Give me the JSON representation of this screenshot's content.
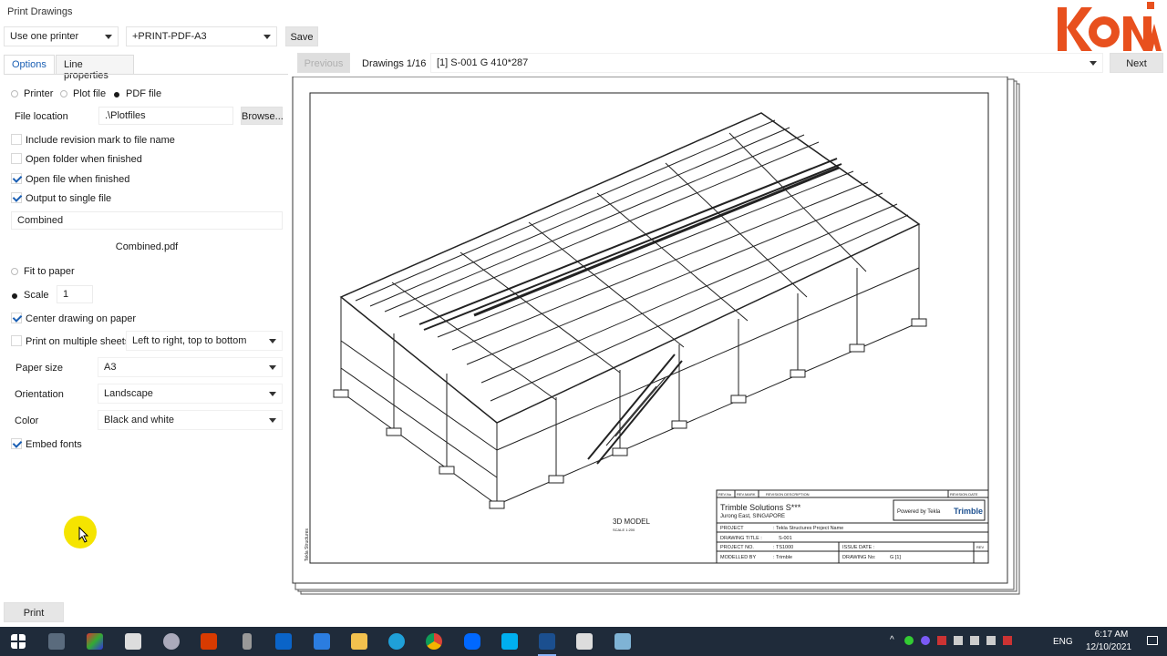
{
  "window": {
    "title": "Print Drawings"
  },
  "toolbar": {
    "printer_mode": "Use one printer",
    "printer_name": "+PRINT-PDF-A3",
    "save_label": "Save"
  },
  "tabs": [
    {
      "label": "Options"
    },
    {
      "label": "Line properties"
    }
  ],
  "options": {
    "output_printer": "Printer",
    "output_plot": "Plot file",
    "output_pdf": "PDF file",
    "file_location_label": "File location",
    "file_location_value": ".\\Plotfiles",
    "browse_label": "Browse...",
    "include_revision": "Include revision mark to file name",
    "open_folder": "Open folder when finished",
    "open_file": "Open file when finished",
    "single_file": "Output to single file",
    "combined_name": "Combined",
    "combined_file": "Combined.pdf",
    "fit_to_paper": "Fit to paper",
    "scale_label": "Scale",
    "scale_value": "1",
    "center_drawing": "Center drawing on paper",
    "multiple_sheets": "Print on multiple sheets",
    "sheet_order": "Left to right, top to bottom",
    "paper_size_label": "Paper size",
    "paper_size_value": "A3",
    "orientation_label": "Orientation",
    "orientation_value": "Landscape",
    "color_label": "Color",
    "color_value": "Black and white",
    "embed_fonts": "Embed fonts",
    "print_label": "Print"
  },
  "preview": {
    "previous_label": "Previous",
    "counter": "Drawings 1/16",
    "drawing_select": "[1] S-001 G 410*287",
    "next_label": "Next"
  },
  "title_block": {
    "rev_no": "REV.No",
    "rev_mark": "REV.MARK",
    "rev_desc": "REVISION DESCRIPTION",
    "rev_date": "REVISION DATE",
    "company": "Trimble Solutions S***",
    "address": "Jurong East, SINGAPORE",
    "powered": "Powered by Tekla",
    "brand": "Trimble",
    "project_label": "PROJECT",
    "project_value": ": Tekla Structures Project Name",
    "drawing_title_label": "DRAWING TITLE :",
    "drawing_title_value": "S-001",
    "project_no_label": "PROJECT NO.",
    "project_no_value": ": TS1000",
    "issue_date_label": "ISSUE DATE :",
    "modelled_label": "MODELLED BY",
    "modelled_value": ": Trimble",
    "drawing_no_label": "DRAWING No:",
    "drawing_no_value": "G   [1]",
    "rev_short": "REV",
    "view_label": "3D MODEL",
    "view_scale": "SCALE 1:200",
    "side_text": "Tekla Structures"
  },
  "logo": {
    "text": "KONIA",
    "color": "#e8501e"
  },
  "taskbar": {
    "lang": "ENG",
    "time": "6:17 AM",
    "date": "12/10/2021",
    "icons": [
      "windows-icon",
      "calculator-icon",
      "color-picker-icon",
      "snipping-icon",
      "network-icon",
      "office-icon",
      "usb-icon",
      "outlook-icon",
      "todo-icon",
      "folder-icon",
      "edge-icon",
      "chrome-icon",
      "zalo-icon",
      "skype-icon",
      "tekla-icon",
      "inkscape-icon",
      "tekla-model-icon"
    ]
  },
  "colors": {
    "accent": "#1a5fb4",
    "taskbar": "#1f2b3a",
    "halo": "#f5e400"
  }
}
